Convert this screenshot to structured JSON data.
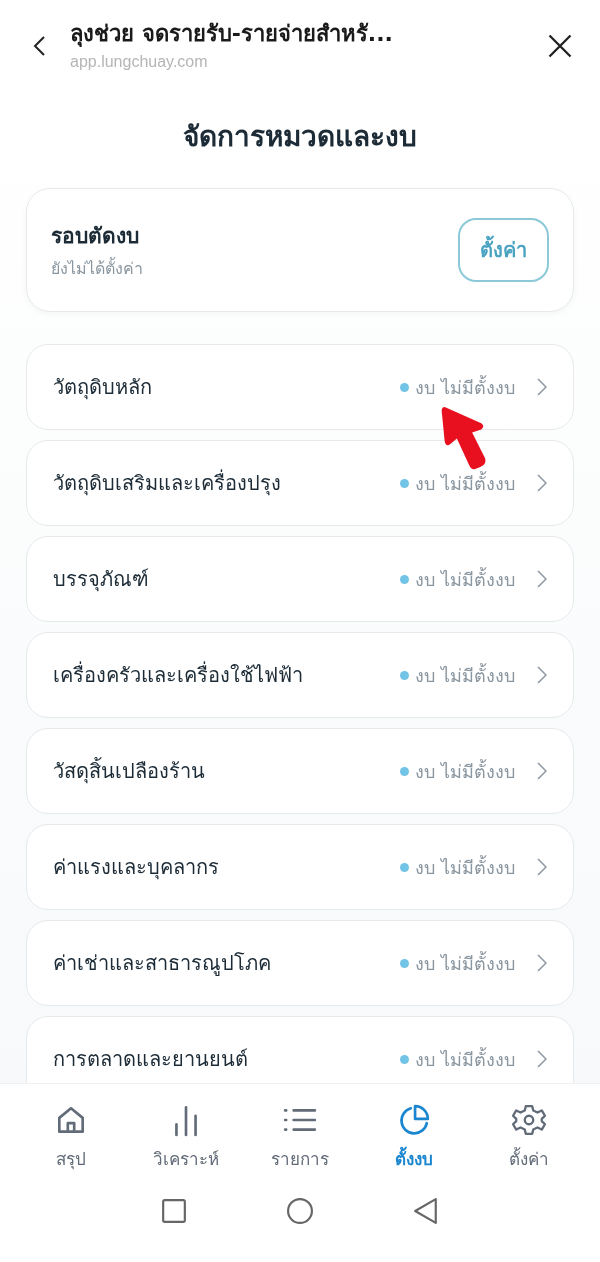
{
  "header": {
    "title": "ลุงช่วย จดรายรับ-รายจ่ายสำหรั...",
    "url": "app.lungchuay.com"
  },
  "page_title": "จัดการหมวดและงบ",
  "budget_cycle": {
    "label": "รอบตัดงบ",
    "status": "ยังไม่ได้ตั้งค่า",
    "button": "ตั้งค่า"
  },
  "categories": [
    {
      "name": "วัตถุดิบหลัก",
      "status": "งบ ไม่มีตั้งงบ"
    },
    {
      "name": "วัตถุดิบเสริมและเครื่องปรุง",
      "status": "งบ ไม่มีตั้งงบ"
    },
    {
      "name": "บรรจุภัณฑ์",
      "status": "งบ ไม่มีตั้งงบ"
    },
    {
      "name": "เครื่องครัวและเครื่องใช้ไฟฟ้า",
      "status": "งบ ไม่มีตั้งงบ"
    },
    {
      "name": "วัสดุสิ้นเปลืองร้าน",
      "status": "งบ ไม่มีตั้งงบ"
    },
    {
      "name": "ค่าแรงและบุคลากร",
      "status": "งบ ไม่มีตั้งงบ"
    },
    {
      "name": "ค่าเช่าและสาธารณูปโภค",
      "status": "งบ ไม่มีตั้งงบ"
    },
    {
      "name": "การตลาดและยานยนต์",
      "status": "งบ ไม่มีตั้งงบ"
    }
  ],
  "tabs": [
    {
      "kind": "home",
      "label": "สรุป",
      "selected": false
    },
    {
      "kind": "bars",
      "label": "วิเคราะห์",
      "selected": false
    },
    {
      "kind": "list",
      "label": "รายการ",
      "selected": false
    },
    {
      "kind": "pie",
      "label": "ตั้งงบ",
      "selected": true
    },
    {
      "kind": "gear",
      "label": "ตั้งค่า",
      "selected": false
    }
  ]
}
